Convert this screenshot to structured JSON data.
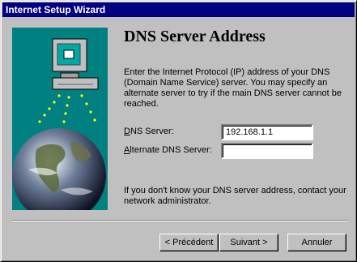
{
  "window": {
    "title": "Internet Setup Wizard"
  },
  "page": {
    "heading": "DNS Server Address",
    "description": "Enter the Internet Protocol (IP) address of your DNS (Domain Name Service) server.  You may specify an alternate server to try if the main DNS server cannot be reached.",
    "note": "If you don't know your DNS server address, contact your network administrator."
  },
  "fields": {
    "dns_label_key": "D",
    "dns_label_rest": "NS Server:",
    "dns_value": "192.168.1.1",
    "alt_label_key": "A",
    "alt_label_rest": "lternate DNS Server:",
    "alt_value": ""
  },
  "buttons": {
    "back": "< Précédent",
    "next": "Suivant >",
    "cancel": "Annuler"
  },
  "illustration": {
    "icon": "computer-globe-network-icon"
  }
}
